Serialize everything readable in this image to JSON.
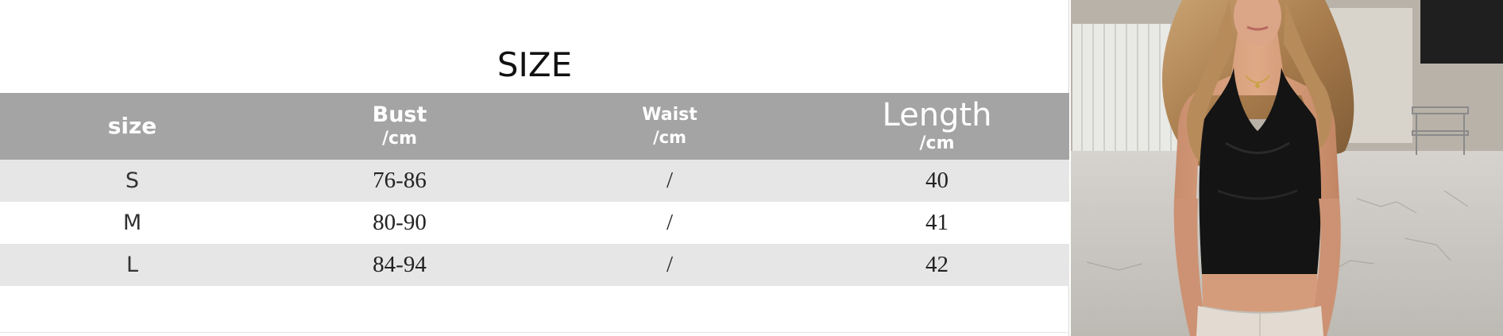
{
  "size_chart": {
    "title": "SIZE",
    "headers": [
      {
        "label": "size",
        "unit": ""
      },
      {
        "label": "Bust",
        "unit": "/cm"
      },
      {
        "label": "Waist",
        "unit": "/cm"
      },
      {
        "label": "Length",
        "unit": "/cm"
      }
    ],
    "rows": [
      [
        "S",
        "76-86",
        "/",
        "40"
      ],
      [
        "M",
        "80-90",
        "/",
        "41"
      ],
      [
        "L",
        "84-94",
        "/",
        "42"
      ]
    ]
  },
  "colors": {
    "header_bg": "#a4a4a4",
    "stripe_bg": "#e6e6e6",
    "garment": "#141414"
  }
}
